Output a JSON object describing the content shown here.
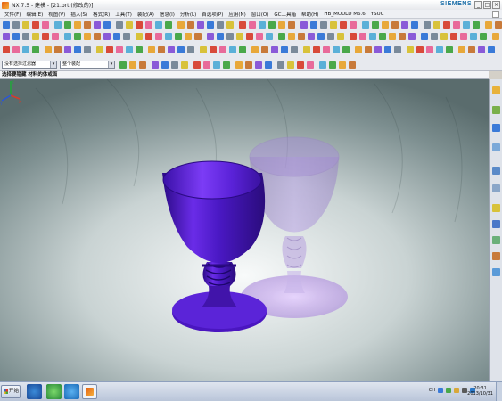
{
  "window": {
    "title": "NX 7.5 - 建模 - [21.prt (修改的)]",
    "brand": "SIEMENS",
    "controls": [
      "_",
      "□",
      "×"
    ]
  },
  "menu": {
    "items": [
      "文件(F)",
      "编辑(E)",
      "视图(V)",
      "插入(S)",
      "格式(R)",
      "工具(T)",
      "装配(A)",
      "信息(I)",
      "分析(L)",
      "首选项(P)",
      "应用(N)",
      "窗口(O)",
      "GC工具箱",
      "帮助(H)",
      "HB_MOULD M6.6",
      "YSUC"
    ]
  },
  "selection_bar": {
    "type_filter": "没有选择过滤器",
    "scope": "整个装配"
  },
  "cue_line": "选择要隐藏 材料的体或面",
  "viewport": {
    "background": "gradient-grey",
    "model_color": "#5a1fd1",
    "ghost_color": "#b896e8"
  },
  "taskbar": {
    "start_label": "开始",
    "tray_text": "CH",
    "time": "20:31",
    "date": "2013/10/31"
  }
}
